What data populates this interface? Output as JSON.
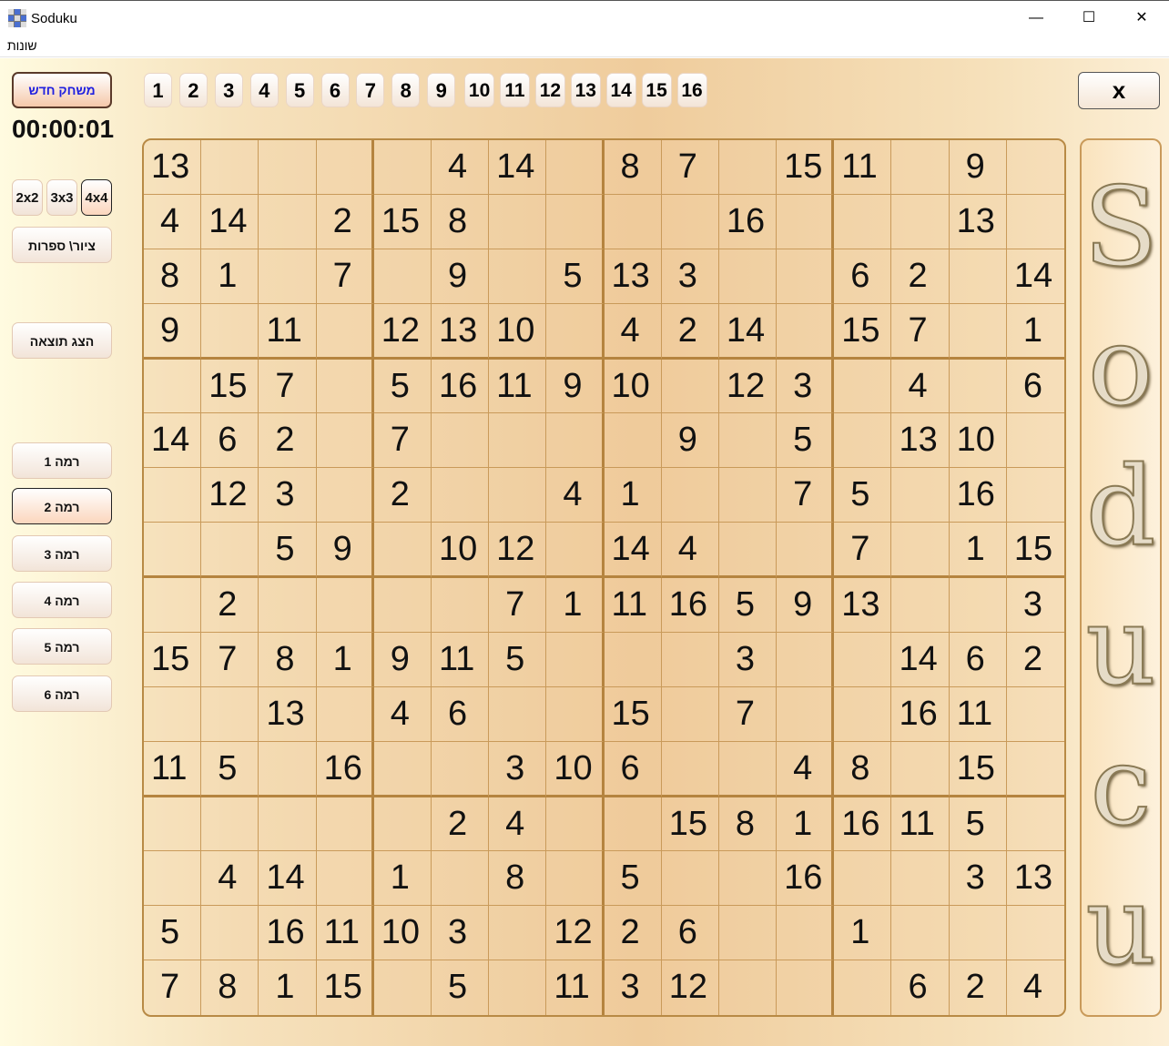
{
  "window": {
    "title": "Soduku",
    "minimize": "—",
    "maximize": "☐",
    "close": "✕"
  },
  "menu": {
    "options": "שונות"
  },
  "sidebar": {
    "new_game": "משחק חדש",
    "timer": "00:00:01",
    "sizes": [
      "2x2",
      "3x3",
      "4x4"
    ],
    "selected_size": "4x4",
    "draw_digits": "ציור\\ ספרות",
    "show_result": "הצג תוצאה",
    "levels": [
      "רמה 1",
      "רמה 2",
      "רמה 3",
      "רמה 4",
      "רמה 5",
      "רמה 6"
    ],
    "selected_level": "רמה 2"
  },
  "number_buttons": [
    "1",
    "2",
    "3",
    "4",
    "5",
    "6",
    "7",
    "8",
    "9",
    "10",
    "11",
    "12",
    "13",
    "14",
    "15",
    "16"
  ],
  "close_button": "x",
  "logo": "Soducu",
  "grid": [
    [
      "13",
      "",
      "",
      "",
      "",
      "4",
      "14",
      "",
      "8",
      "7",
      "",
      "15",
      "11",
      "",
      "9",
      ""
    ],
    [
      "4",
      "14",
      "",
      "2",
      "15",
      "8",
      "",
      "",
      "",
      "",
      "16",
      "",
      "",
      "",
      "13",
      ""
    ],
    [
      "8",
      "1",
      "",
      "7",
      "",
      "9",
      "",
      "5",
      "13",
      "3",
      "",
      "",
      "6",
      "2",
      "",
      "14"
    ],
    [
      "9",
      "",
      "11",
      "",
      "12",
      "13",
      "10",
      "",
      "4",
      "2",
      "14",
      "",
      "15",
      "7",
      "",
      "1"
    ],
    [
      "",
      "15",
      "7",
      "",
      "5",
      "16",
      "11",
      "9",
      "10",
      "",
      "12",
      "3",
      "",
      "4",
      "",
      "6"
    ],
    [
      "14",
      "6",
      "2",
      "",
      "7",
      "",
      "",
      "",
      "",
      "9",
      "",
      "5",
      "",
      "13",
      "10",
      ""
    ],
    [
      "",
      "12",
      "3",
      "",
      "2",
      "",
      "",
      "4",
      "1",
      "",
      "",
      "7",
      "5",
      "",
      "16",
      ""
    ],
    [
      "",
      "",
      "5",
      "9",
      "",
      "10",
      "12",
      "",
      "14",
      "4",
      "",
      "",
      "7",
      "",
      "1",
      "15"
    ],
    [
      "",
      "2",
      "",
      "",
      "",
      "",
      "7",
      "1",
      "11",
      "16",
      "5",
      "9",
      "13",
      "",
      "",
      "3"
    ],
    [
      "15",
      "7",
      "8",
      "1",
      "9",
      "11",
      "5",
      "",
      "",
      "",
      "3",
      "",
      "",
      "14",
      "6",
      "2"
    ],
    [
      "",
      "",
      "13",
      "",
      "4",
      "6",
      "",
      "",
      "15",
      "",
      "7",
      "",
      "",
      "16",
      "11",
      ""
    ],
    [
      "11",
      "5",
      "",
      "16",
      "",
      "",
      "3",
      "10",
      "6",
      "",
      "",
      "4",
      "8",
      "",
      "15",
      ""
    ],
    [
      "",
      "",
      "",
      "",
      "",
      "2",
      "4",
      "",
      "",
      "15",
      "8",
      "1",
      "16",
      "11",
      "5",
      ""
    ],
    [
      "",
      "4",
      "14",
      "",
      "1",
      "",
      "8",
      "",
      "5",
      "",
      "",
      "16",
      "",
      "",
      "3",
      "13"
    ],
    [
      "5",
      "",
      "16",
      "11",
      "10",
      "3",
      "",
      "12",
      "2",
      "6",
      "",
      "",
      "1",
      "",
      "",
      ""
    ],
    [
      "7",
      "8",
      "1",
      "15",
      "",
      "5",
      "",
      "11",
      "3",
      "12",
      "",
      "",
      "",
      "6",
      "2",
      "4"
    ]
  ]
}
